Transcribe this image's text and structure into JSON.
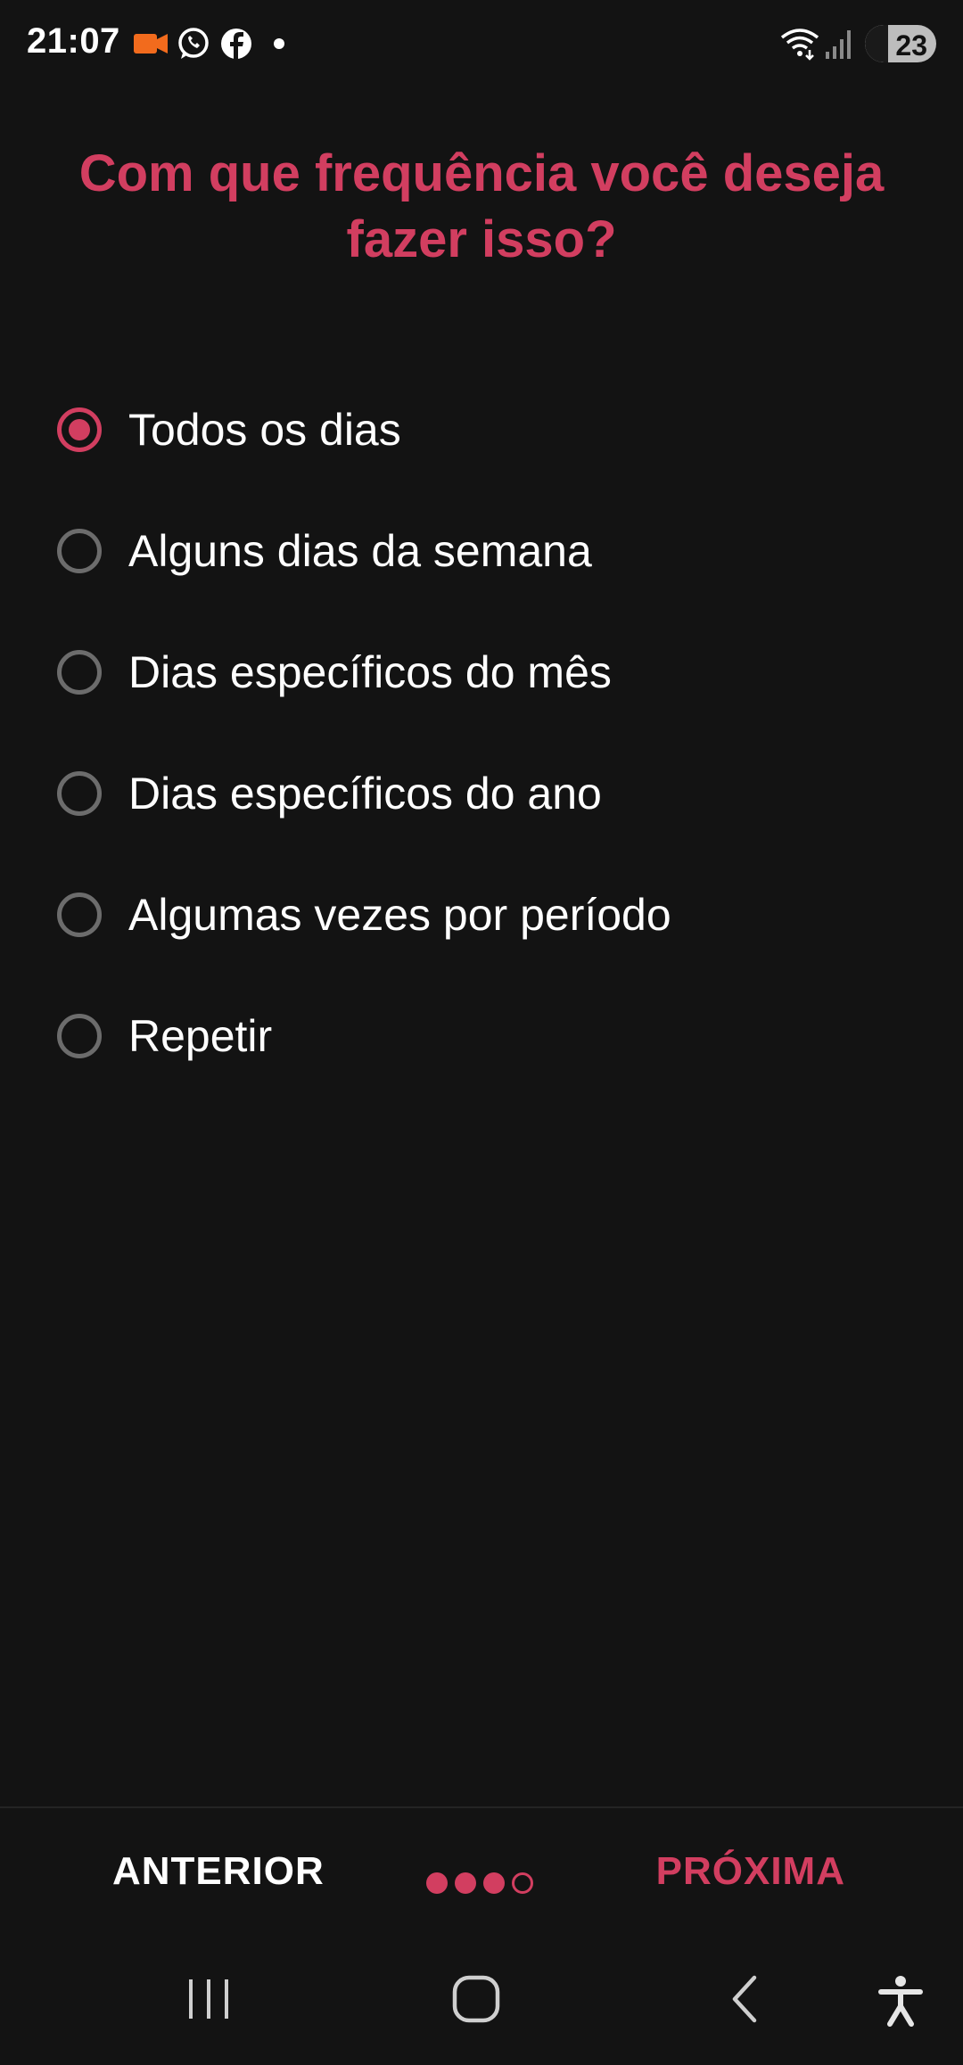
{
  "status_bar": {
    "time": "21:07",
    "battery": "23",
    "icons": [
      "video-camera-icon",
      "whatsapp-icon",
      "facebook-icon",
      "notification-dot-icon",
      "wifi-icon",
      "signal-icon",
      "battery-icon"
    ],
    "colors": {
      "video_icon": "#f26b1d"
    }
  },
  "question": {
    "title": "Com que frequência você deseja fazer isso?"
  },
  "options": [
    {
      "label": "Todos os dias",
      "selected": true
    },
    {
      "label": "Alguns dias da semana",
      "selected": false
    },
    {
      "label": "Dias específicos do mês",
      "selected": false
    },
    {
      "label": "Dias específicos do ano",
      "selected": false
    },
    {
      "label": "Algumas vezes por período",
      "selected": false
    },
    {
      "label": "Repetir",
      "selected": false
    }
  ],
  "bottom_bar": {
    "previous_label": "ANTERIOR",
    "next_label": "PRÓXIMA",
    "progress": {
      "current_step": 3,
      "total_steps": 4
    }
  },
  "system_nav": {
    "icons": [
      "recent-apps-icon",
      "home-icon",
      "back-icon",
      "accessibility-icon"
    ]
  },
  "colors": {
    "accent": "#d23e60",
    "background": "#131313",
    "text": "#ffffff",
    "radio_unselected": "#6c6c6c"
  }
}
